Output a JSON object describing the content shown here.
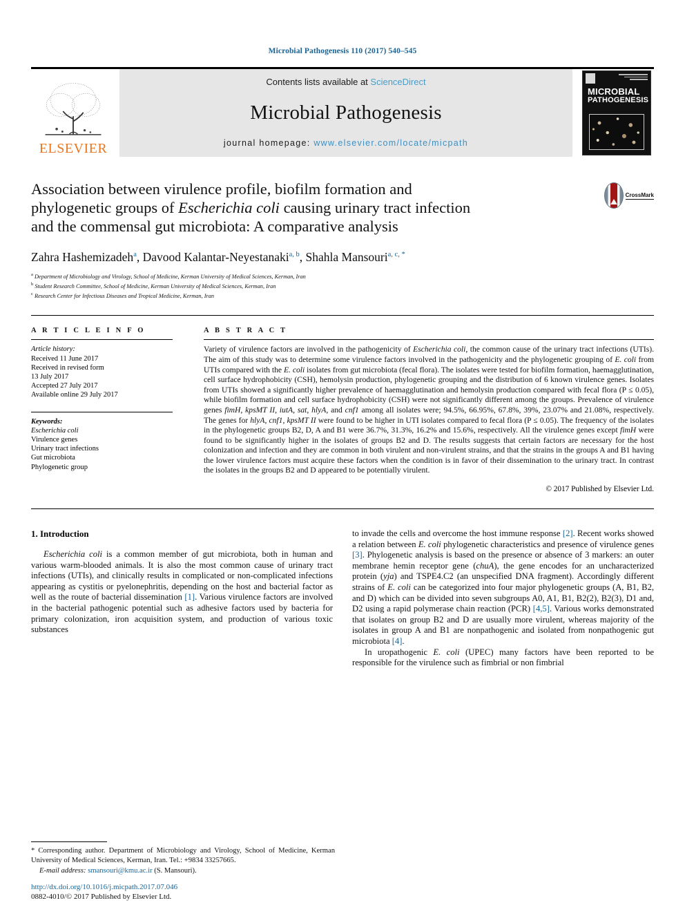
{
  "running_head": "Microbial Pathogenesis 110 (2017) 540–545",
  "masthead": {
    "publisher_name": "ELSEVIER",
    "contents_prefix": "Contents lists available at ",
    "contents_link": "ScienceDirect",
    "journal_title": "Microbial Pathogenesis",
    "homepage_prefix": "journal homepage: ",
    "homepage_url": "www.elsevier.com/locate/micpath",
    "cover_title_line1": "MICROBIAL",
    "cover_title_line2": "PATHOGENESIS"
  },
  "article": {
    "title_line1": "Association between virulence profile, biofilm formation and",
    "title_line2_a": "phylogenetic groups of ",
    "title_line2_it": "Escherichia coli",
    "title_line2_b": " causing urinary tract infection",
    "title_line3": "and the commensal gut microbiota: A comparative analysis",
    "authors": [
      {
        "name": "Zahra Hashemizadeh",
        "marks": "a"
      },
      {
        "name": "Davood Kalantar-Neyestanaki",
        "marks": "a, b"
      },
      {
        "name": "Shahla Mansouri",
        "marks": "a, c, *"
      }
    ],
    "affiliations": [
      {
        "mark": "a",
        "text": "Department of Microbiology and Virology, School of Medicine, Kerman University of Medical Sciences, Kerman, Iran"
      },
      {
        "mark": "b",
        "text": "Student Research Committee, School of Medicine, Kerman University of Medical Sciences, Kerman, Iran"
      },
      {
        "mark": "c",
        "text": "Research Center for Infectious Diseases and Tropical Medicine, Kerman, Iran"
      }
    ],
    "crossmark_label": "CrossMark"
  },
  "info": {
    "heading": "A R T I C L E   I N F O",
    "history_label": "Article history:",
    "history": [
      "Received 11 June 2017",
      "Received in revised form",
      "13 July 2017",
      "Accepted 27 July 2017",
      "Available online 29 July 2017"
    ],
    "keywords_label": "Keywords:",
    "keywords": [
      "Escherichia coli",
      "Virulence genes",
      "Urinary tract infections",
      "Gut microbiota",
      "Phylogenetic group"
    ]
  },
  "abstract": {
    "heading": "A B S T R A C T",
    "text_part1": "Variety of virulence factors are involved in the pathogenicity of ",
    "it1": "Escherichia coli",
    "text_part2": ", the common cause of the urinary tract infections (UTIs). The aim of this study was to determine some virulence factors involved in the pathogenicity and the phylogenetic grouping of ",
    "it2": "E. coli",
    "text_part3": " from UTIs compared with the ",
    "it3": "E. coli",
    "text_part4": " isolates from gut microbiota (fecal flora). The isolates were tested for biofilm formation, haemagglutination, cell surface hydrophobicity (CSH), hemolysin production, phylogenetic grouping and the distribution of 6 known virulence genes. Isolates from UTIs showed a significantly higher prevalence of haemagglutination and hemolysin production compared with fecal flora (P ≤ 0.05), while biofilm formation and cell surface hydrophobicity (CSH) were not significantly different among the groups. Prevalence of virulence genes ",
    "it4": "fimH",
    "text_part5": ", ",
    "it5": "kpsMT II",
    "text_part6": ", ",
    "it6": "iutA",
    "text_part7": ", ",
    "it7": "sat",
    "text_part8": ", ",
    "it8": "hlyA",
    "text_part9": ", and ",
    "it9": "cnf1",
    "text_part10": " among all isolates were; 94.5%, 66.95%, 67.8%, 39%, 23.07% and 21.08%, respectively. The genes for ",
    "it10": "hlyA",
    "text_part11": ", ",
    "it11": "cnf1",
    "text_part12": ", ",
    "it12": "kpsMT II",
    "text_part13": " were found to be higher in UTI isolates compared to fecal flora (P ≤ 0.05). The frequency of the isolates in the phylogenetic groups B2, D, A and B1 were 36.7%, 31.3%, 16.2% and 15.6%, respectively. All the virulence genes except ",
    "it13": "fimH",
    "text_part14": " were found to be significantly higher in the isolates of groups B2 and D. The results suggests that certain factors are necessary for the host colonization and infection and they are common in both virulent and non-virulent strains, and that the strains in the groups A and B1 having the lower virulence factors must acquire these factors when the condition is in favor of their dissemination to the urinary tract. In contrast the isolates in the groups B2 and D appeared to be potentially virulent.",
    "copyright": "© 2017 Published by Elsevier Ltd."
  },
  "body": {
    "section_number_title": "1. Introduction",
    "left_p1_it": "Escherichia coli",
    "left_p1_a": " is a common member of gut microbiota, both in human and various warm-blooded animals. It is also the most common cause of urinary tract infections (UTIs), and clinically results in complicated or non-complicated infections appearing as cystitis or pyelonephritis, depending on the host and bacterial factor as well as the route of bacterial dissemination ",
    "left_ref1": "[1]",
    "left_p1_b": ". Various virulence factors are involved in the bacterial pathogenic potential such as adhesive factors used by bacteria for primary colonization, iron acquisition system, and production of various toxic substances",
    "right_p1_a": "to invade the cells and overcome the host immune response ",
    "right_ref2": "[2]",
    "right_p1_b": ". Recent works showed a relation between ",
    "right_it1": "E. coli",
    "right_p1_c": " phylogenetic characteristics and presence of virulence genes ",
    "right_ref3": "[3]",
    "right_p1_d": ". Phylogenetic analysis is based on the presence or absence of 3 markers: an outer membrane hemin receptor gene (",
    "right_it2": "chuA",
    "right_p1_e": "), the gene encodes for an uncharacterized protein (",
    "right_it3": "yja",
    "right_p1_f": ") and TSPE4.C2 (an unspecified DNA fragment). Accordingly different strains of ",
    "right_it4": "E. coli",
    "right_p1_g": " can be categorized into four major phylogenetic groups (A, B1, B2, and D) which can be divided into seven subgroups A0, A1, B1, B2(2), B2(3), D1 and, D2 using a rapid polymerase chain reaction (PCR) ",
    "right_ref45": "[4,5]",
    "right_p1_h": ". Various works demonstrated that isolates on group B2 and D are usually more virulent, whereas majority of the isolates in group A and B1 are nonpathogenic and isolated from nonpathogenic gut microbiota ",
    "right_ref4": "[4]",
    "right_p1_i": ".",
    "right_p2_a": "In uropathogenic ",
    "right_p2_it": "E. coli",
    "right_p2_b": " (UPEC) many factors have been reported to be responsible for the virulence such as fimbrial or non fimbrial"
  },
  "footer": {
    "corresponding_star": "*",
    "corresponding_text": " Corresponding author. Department of Microbiology and Virology, School of Medicine, Kerman University of Medical Sciences, Kerman, Iran. Tel.: +9834 33257665.",
    "email_label": "E-mail address:",
    "email": "smansouri@kmu.ac.ir",
    "email_suffix": " (S. Mansouri).",
    "doi": "http://dx.doi.org/10.1016/j.micpath.2017.07.046",
    "issn_line": "0882-4010/© 2017 Published by Elsevier Ltd."
  },
  "colors": {
    "link_blue": "#1a6496",
    "sciencedirect_blue": "#4a9cc8",
    "elsevier_orange": "#e87722",
    "band_gray": "#e6e6e6"
  }
}
